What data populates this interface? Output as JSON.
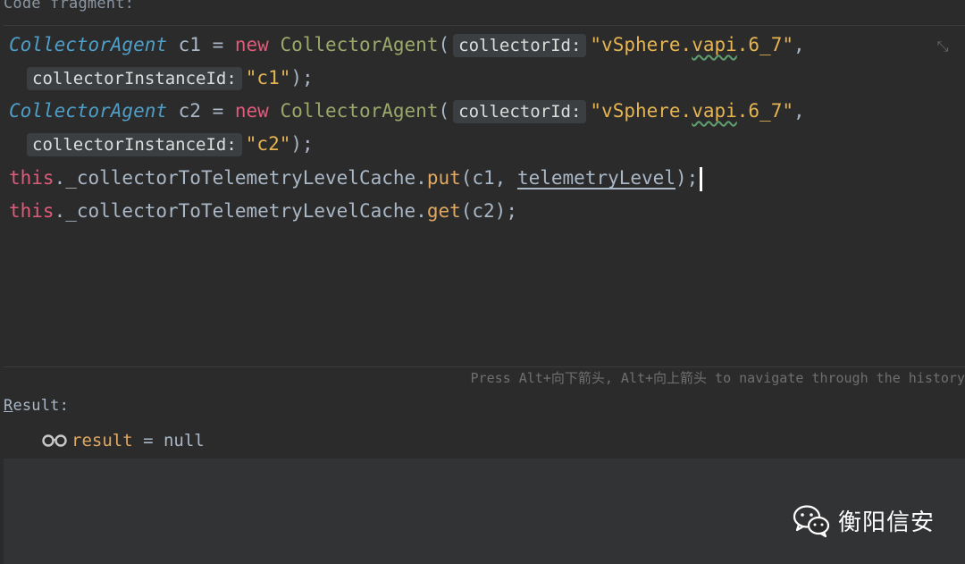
{
  "code_label": "Code fragment:",
  "code_lines": {
    "l1_class": "CollectorAgent",
    "l1_var": " c1 = ",
    "l1_new": "new",
    "l1_ctor": " CollectorAgent",
    "l1_paren": "(",
    "l1_hint": "collectorId:",
    "l1_str_pre": "\"vSphere.",
    "l1_str_squig": "vapi",
    "l1_str_post": ".6_7\"",
    "l1_comma": ",",
    "l2_hint": "collectorInstanceId:",
    "l2_str": "\"c1\"",
    "l2_end": ");",
    "l3_class": "CollectorAgent",
    "l3_var": " c2 = ",
    "l3_new": "new",
    "l3_ctor": " CollectorAgent",
    "l3_paren": "(",
    "l3_hint": "collectorId:",
    "l3_str_pre": "\"vSphere.",
    "l3_str_squig": "vapi",
    "l3_str_post": ".6_7\"",
    "l3_comma": ",",
    "l4_hint": "collectorInstanceId:",
    "l4_str": "\"c2\"",
    "l4_end": ");",
    "l5_this": "this",
    "l5_field": "._collectorToTelemetryLevelCache.",
    "l5_method": "put",
    "l5_args_pre": "(c1, ",
    "l5_arg_underlined": "telemetryLevel",
    "l5_end": ");",
    "l6_this": "this",
    "l6_field": "._collectorToTelemetryLevelCache.",
    "l6_method": "get",
    "l6_args": "(c2);"
  },
  "history_hint": "Press Alt+向下箭头, Alt+向上箭头 to navigate through the history",
  "result_label_first": "R",
  "result_label_rest": "esult:",
  "result": {
    "icon": "watch-glasses-icon",
    "name": "result",
    "eq": " = ",
    "value": "null"
  },
  "watermark": {
    "icon": "wechat-icon",
    "text": "衡阳信安"
  },
  "colors": {
    "background": "#2b2b2b",
    "keyword": "#cc7832",
    "string": "#e6b451",
    "this_keyword": "#e05a7a",
    "class_italic": "#4e9ec7"
  }
}
